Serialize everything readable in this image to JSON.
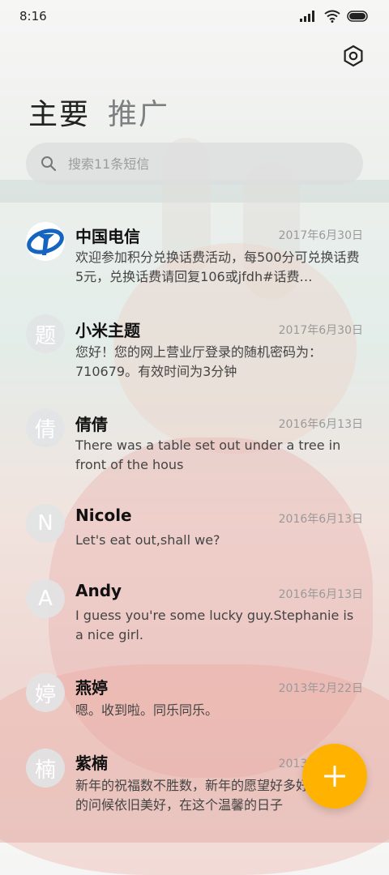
{
  "status_bar": {
    "time": "8:16"
  },
  "tabs": [
    {
      "label": "主要"
    },
    {
      "label": "推广"
    }
  ],
  "search": {
    "placeholder": "搜索11条短信"
  },
  "messages": [
    {
      "avatar": "",
      "name": "中国电信",
      "date": "2017年6月30日",
      "preview": "欢迎参加积分兑换话费活动，每500分可兑换话费5元，兑换话费请回复106或jfdh#话费…"
    },
    {
      "avatar": "题",
      "name": "小米主题",
      "date": "2017年6月30日",
      "preview": "您好！您的网上营业厅登录的随机密码为：710679。有效时间为3分钟"
    },
    {
      "avatar": "倩",
      "name": "倩倩",
      "date": "2016年6月13日",
      "preview": "There was a table set out under a tree in front of the hous"
    },
    {
      "avatar": "N",
      "name": "Nicole",
      "date": "2016年6月13日",
      "preview": "Let's eat out,shall we?"
    },
    {
      "avatar": "A",
      "name": "Andy",
      "date": "2016年6月13日",
      "preview": "I guess you're some lucky guy.Stephanie is a nice girl."
    },
    {
      "avatar": "婷",
      "name": "燕婷",
      "date": "2013年2月22日",
      "preview": "嗯。收到啦。同乐同乐。"
    },
    {
      "avatar": "楠",
      "name": "紫楠",
      "date": "2013年2月22日",
      "preview": "新年的祝福数不胜数，新年的愿望好多好多，新年的问候依旧美好，在这个温馨的日子"
    }
  ],
  "colors": {
    "fab": "#ffb300",
    "telecom_blue": "#1565c0"
  }
}
